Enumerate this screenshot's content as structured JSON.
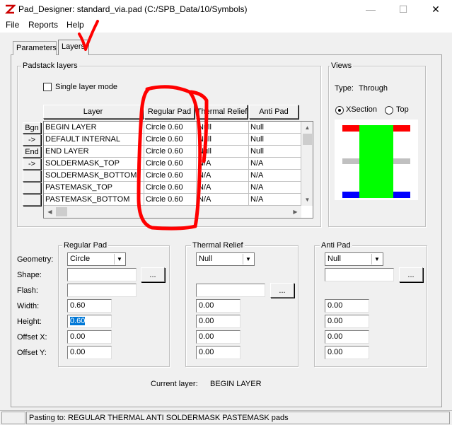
{
  "window": {
    "title": "Pad_Designer: standard_via.pad (C:/SPB_Data/10/Symbols)",
    "minimize": "—",
    "maximize": "☐",
    "close": "✕"
  },
  "menu": {
    "file": "File",
    "reports": "Reports",
    "help": "Help"
  },
  "tabs": {
    "parameters": "Parameters",
    "layers": "Layers"
  },
  "padstack": {
    "group_label": "Padstack layers",
    "single_layer_mode": "Single layer mode",
    "single_layer_checked": false,
    "columns": [
      "Layer",
      "Regular Pad",
      "Thermal Relief",
      "Anti Pad"
    ],
    "row_buttons": [
      "Bgn",
      "->",
      "End",
      "->",
      "",
      "",
      ""
    ],
    "rows": [
      [
        "BEGIN LAYER",
        "Circle 0.60",
        "Null",
        "Null"
      ],
      [
        "DEFAULT INTERNAL",
        "Circle 0.60",
        "Null",
        "Null"
      ],
      [
        "END LAYER",
        "Circle 0.60",
        "Null",
        "Null"
      ],
      [
        "SOLDERMASK_TOP",
        "Circle 0.60",
        "N/A",
        "N/A"
      ],
      [
        "SOLDERMASK_BOTTOM",
        "Circle 0.60",
        "N/A",
        "N/A"
      ],
      [
        "PASTEMASK_TOP",
        "Circle 0.60",
        "N/A",
        "N/A"
      ],
      [
        "PASTEMASK_BOTTOM",
        "Circle 0.60",
        "N/A",
        "N/A"
      ]
    ]
  },
  "views": {
    "group_label": "Views",
    "type_label": "Type:",
    "type_value": "Through",
    "xsection": "XSection",
    "top": "Top",
    "selected": "XSection",
    "colors": {
      "top_layer": "#ff0000",
      "body": "#00ff00",
      "internal": "#c0c0c0",
      "bottom_layer": "#0000ff"
    }
  },
  "field_labels": {
    "geometry": "Geometry:",
    "shape": "Shape:",
    "flash": "Flash:",
    "width": "Width:",
    "height": "Height:",
    "offset_x": "Offset X:",
    "offset_y": "Offset Y:"
  },
  "regular_pad": {
    "label": "Regular Pad",
    "geometry": "Circle",
    "shape": "",
    "flash": "",
    "width": "0.60",
    "height": "0.60",
    "offset_x": "0.00",
    "offset_y": "0.00"
  },
  "thermal_relief": {
    "label": "Thermal Relief",
    "geometry": "Null",
    "flash": "",
    "width": "0.00",
    "height": "0.00",
    "offset_x": "0.00",
    "offset_y": "0.00"
  },
  "anti_pad": {
    "label": "Anti Pad",
    "geometry": "Null",
    "shape": "",
    "width": "0.00",
    "height": "0.00",
    "offset_x": "0.00",
    "offset_y": "0.00"
  },
  "browse_label": "...",
  "current_layer": {
    "label": "Current layer:",
    "value": "BEGIN LAYER"
  },
  "status": {
    "pasting": "Pasting to: REGULAR  THERMAL  ANTI  SOLDERMASK  PASTEMASK  pads"
  },
  "annotation_color": "#ff0000"
}
